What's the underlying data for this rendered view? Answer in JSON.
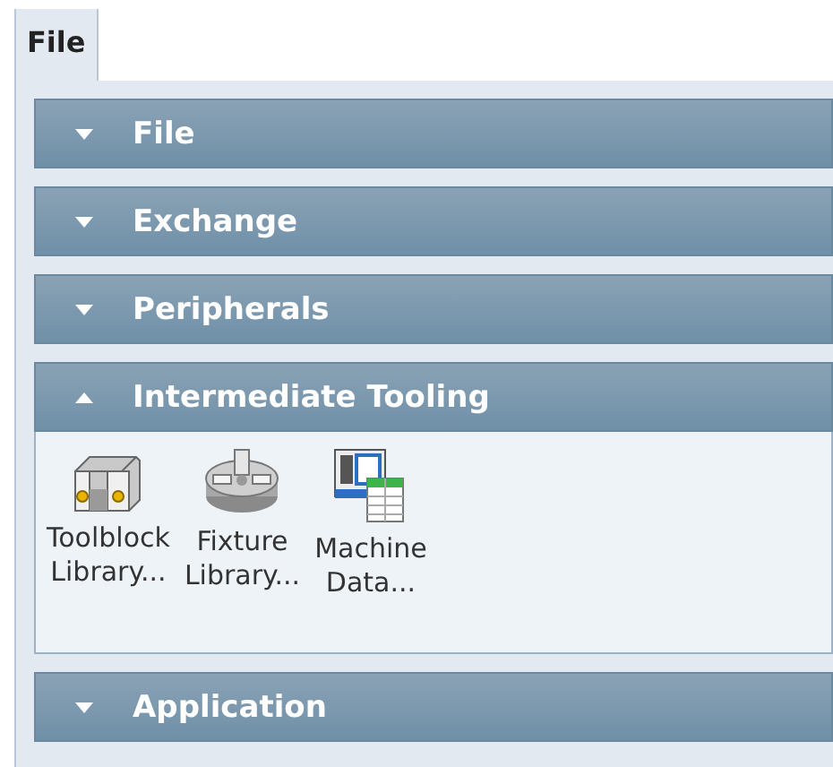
{
  "tabs": [
    {
      "label": "File",
      "selected": true
    }
  ],
  "sections": [
    {
      "title": "File",
      "expanded": false
    },
    {
      "title": "Exchange",
      "expanded": false
    },
    {
      "title": "Peripherals",
      "expanded": false
    },
    {
      "title": "Intermediate Tooling",
      "expanded": true,
      "items": [
        {
          "kind": "toolblock",
          "label": "Toolblock\nLibrary..."
        },
        {
          "kind": "fixture",
          "label": "Fixture\nLibrary..."
        },
        {
          "kind": "machine",
          "label": "Machine\nData..."
        }
      ]
    },
    {
      "title": "Application",
      "expanded": false
    }
  ]
}
